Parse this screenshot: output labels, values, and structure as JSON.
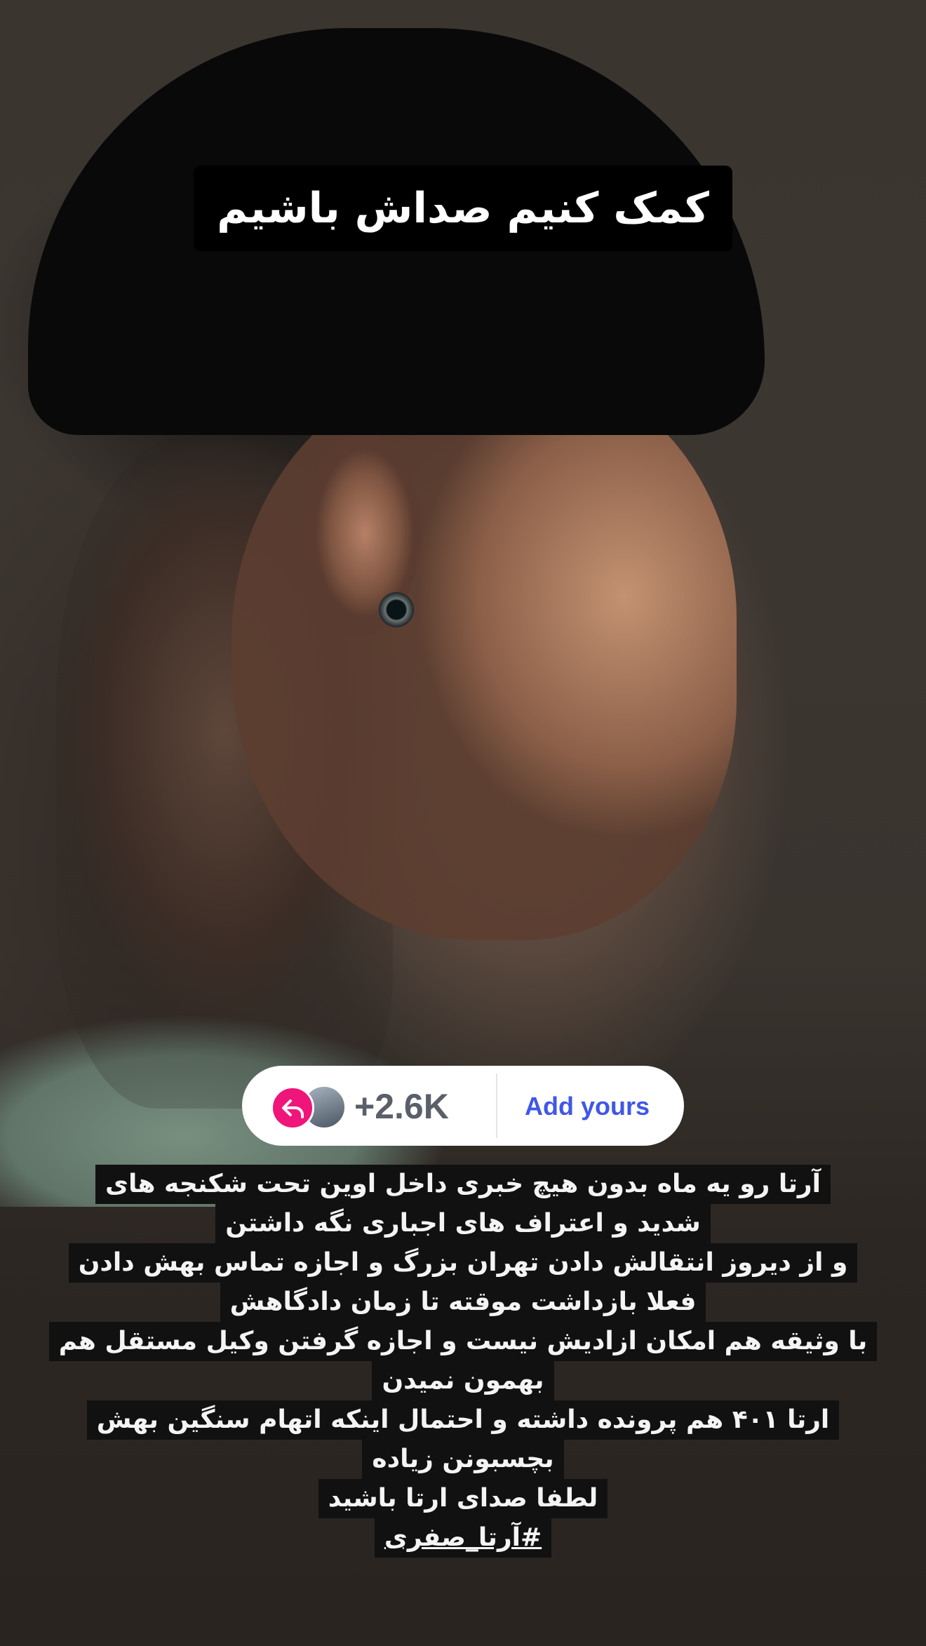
{
  "story": {
    "title": "کمک کنیم صداش باشیم",
    "add_yours": {
      "count": "+2.6K",
      "label": "Add yours"
    },
    "caption_lines": [
      "آرتا رو یه ماه بدون هیچ خبری داخل اوین تحت شکنجه های",
      "شدید و اعتراف های اجباری نگه داشتن",
      "و از دیروز انتقالش دادن تهران بزرگ و اجازه تماس بهش دادن",
      "فعلا بازداشت موقته تا زمان دادگاهش",
      "با وثیقه هم امکان ازادیش نیست و اجازه گرفتن وکیل مستقل هم",
      "بهمون نمیدن",
      "ارتا ۴۰۱ هم پرونده داشته و احتمال اینکه اتهام سنگین بهش",
      "بچسبونن زیاده",
      "لطفا صدای ارتا باشید",
      "#آرتا_صفری"
    ]
  },
  "icons": {
    "reply": "reply-arrow-icon",
    "avatar": "profile-avatar"
  },
  "colors": {
    "reply_badge": "#f0157a",
    "add_yours_text": "#4057e8",
    "caption_bg": "#111111"
  }
}
